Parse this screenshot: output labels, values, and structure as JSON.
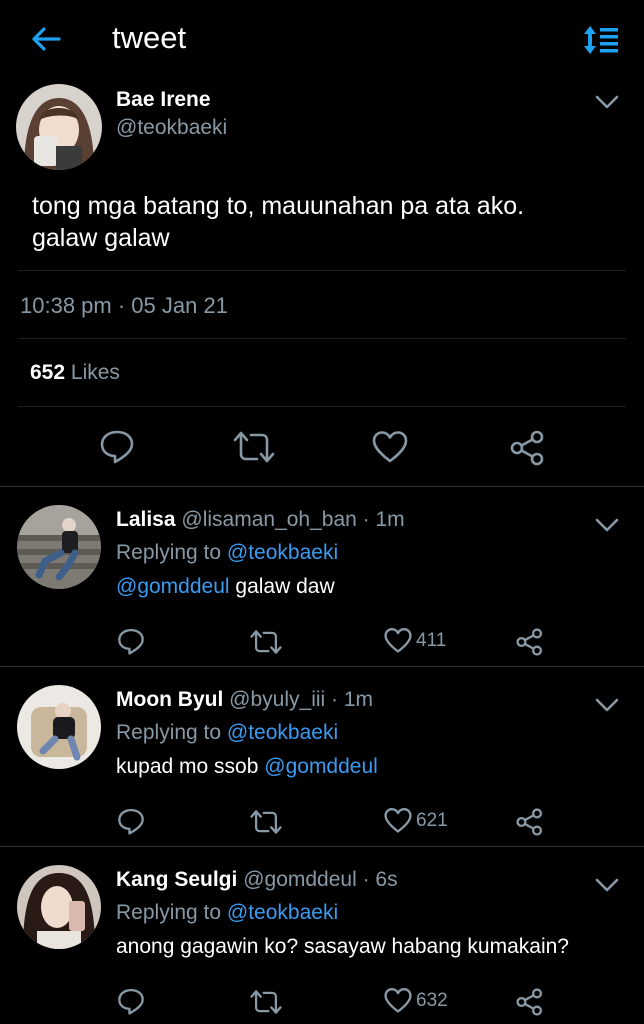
{
  "header": {
    "title": "tweet",
    "back_icon": "arrow-left-icon",
    "sort_icon": "sort-list-icon",
    "accent": "#1da1f2"
  },
  "main_tweet": {
    "name": "Bae Irene",
    "handle": "@teokbaeki",
    "text_line1": "tong mga batang to, mauunahan pa ata ako.",
    "text_line2": "galaw galaw",
    "timestamp": "10:38 pm · 05 Jan 21",
    "likes_count": "652",
    "likes_label": "Likes"
  },
  "replies": [
    {
      "name": "Lalisa",
      "handle": "@lisaman_oh_ban",
      "time": "· 1m",
      "replying_label": "Replying to",
      "replying_to": "@teokbaeki",
      "mention": "@gomddeul",
      "text": "galaw daw",
      "likes": "411"
    },
    {
      "name": "Moon Byul",
      "handle": "@byuly_iii",
      "time": "· 1m",
      "replying_label": "Replying to",
      "replying_to": "@teokbaeki",
      "text": "kupad mo ssob",
      "mention": "@gomddeul",
      "likes": "621"
    },
    {
      "name": "Kang Seulgi",
      "handle": "@gomddeul",
      "time": "· 6s",
      "replying_label": "Replying to",
      "replying_to": "@teokbaeki",
      "text": "anong gagawin ko? sasayaw habang kumakain?",
      "likes": "632"
    }
  ]
}
